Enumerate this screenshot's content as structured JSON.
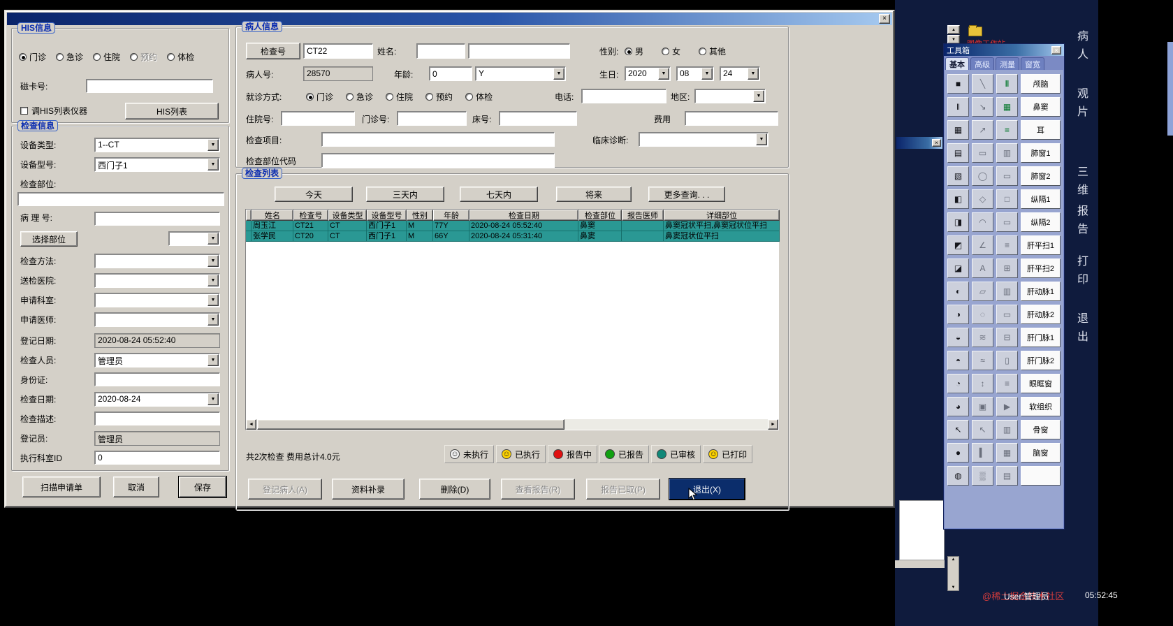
{
  "glyphs": {
    "arrow_down": "▼",
    "arrow_up": "▲",
    "arrow_left": "◄",
    "arrow_right": "►",
    "close": "×",
    "smiley": "☺"
  },
  "his": {
    "title": "HIS信息",
    "radios": [
      {
        "label": "门诊",
        "checked": true
      },
      {
        "label": "急诊"
      },
      {
        "label": "住院"
      },
      {
        "label": "预约",
        "disabled": true
      },
      {
        "label": "体检"
      }
    ],
    "card_label": "磁卡号:",
    "checkbox_label": "调HIS列表仪器",
    "his_list_button": "HIS列表"
  },
  "exam": {
    "title": "检查信息",
    "device_type_label": "设备类型:",
    "device_type": "1--CT",
    "device_model_label": "设备型号:",
    "device_model": "西门子1",
    "body_part_label": "检查部位:",
    "pathology_label": "病 理 号:",
    "select_part_button": "选择部位",
    "method_label": "检查方法:",
    "send_hospital_label": "送检医院:",
    "req_dept_label": "申请科室:",
    "req_doctor_label": "申请医师:",
    "reg_date_label": "登记日期:",
    "reg_date": "2020-08-24 05:52:40",
    "examiner_label": "检查人员:",
    "examiner": "管理员",
    "id_card_label": "身份证:",
    "exam_date_label": "检查日期:",
    "exam_date": "2020-08-24",
    "exam_desc_label": "检查描述:",
    "registrar_label": "登记员:",
    "registrar": "管理员",
    "exec_dept_label": "执行科室ID",
    "exec_dept": "0",
    "scan_button": "扫描申请单",
    "cancel_button": "取消",
    "save_button": "保存"
  },
  "patient": {
    "title": "病人信息",
    "exam_no_button": "检查号",
    "exam_no": "CT22",
    "name_label": "姓名:",
    "gender_label": "性别:",
    "genders": [
      {
        "label": "男",
        "checked": true
      },
      {
        "label": "女"
      },
      {
        "label": "其他"
      }
    ],
    "patient_no_label": "病人号:",
    "patient_no": "28570",
    "age_label": "年龄:",
    "age": "0",
    "age_unit": "Y",
    "birth_label": "生日:",
    "birth_year": "2020",
    "birth_month": "08",
    "birth_day": "24",
    "visit_label": "就诊方式:",
    "visit_radios": [
      {
        "label": "门诊",
        "checked": true
      },
      {
        "label": "急诊"
      },
      {
        "label": "住院"
      },
      {
        "label": "预约"
      },
      {
        "label": "体检"
      }
    ],
    "phone_label": "电话:",
    "region_label": "地区:",
    "inpatient_no_label": "住院号:",
    "outpatient_no_label": "门诊号:",
    "bed_no_label": "床号:",
    "fee_label": "费用",
    "exam_items_label": "检查项目:",
    "clinical_dx_label": "临床诊断:",
    "part_code_label": "检查部位代码"
  },
  "list": {
    "title": "检查列表",
    "quick_buttons": [
      "今天",
      "三天内",
      "七天内",
      "将来",
      "更多查询. . ."
    ],
    "columns": [
      "姓名",
      "检查号",
      "设备类型",
      "设备型号",
      "性别",
      "年龄",
      "检查日期",
      "检查部位",
      "报告医师",
      "详细部位"
    ],
    "rows": [
      [
        "周玉江",
        "CT21",
        "CT",
        "西门子1",
        "M",
        "77Y",
        "2020-08-24 05:52:40",
        "鼻窦",
        "",
        "鼻窦冠状平扫,鼻窦冠状位平扫"
      ],
      [
        "张学民",
        "CT20",
        "CT",
        "西门子1",
        "M",
        "66Y",
        "2020-08-24 05:31:40",
        "鼻窦",
        "",
        "鼻窦冠状位平扫"
      ]
    ],
    "summary": "共2次检查  费用总计4.0元",
    "statuses": [
      {
        "label": "未执行",
        "icon": "smiley",
        "color": "#f2f2f2"
      },
      {
        "label": "已执行",
        "icon": "smiley",
        "color": "#ffd400"
      },
      {
        "label": "报告中",
        "icon": "ball",
        "color": "#e01010"
      },
      {
        "label": "已报告",
        "icon": "ball",
        "color": "#10a010"
      },
      {
        "label": "已审核",
        "icon": "ball",
        "color": "#108878"
      },
      {
        "label": "已打印",
        "icon": "smiley",
        "color": "#ffd400"
      }
    ],
    "actions": [
      {
        "label": "登记病人(A)",
        "disabled": true
      },
      {
        "label": "资料补录"
      },
      {
        "label": "删除(D)"
      },
      {
        "label": "查看报告(R)",
        "disabled": true
      },
      {
        "label": "报告已取(P)",
        "disabled": true
      },
      {
        "label": "退出(X)",
        "primary": true
      }
    ]
  },
  "toolbox": {
    "title": "工具箱",
    "tabs": [
      {
        "label": "基本",
        "active": true
      },
      {
        "label": "高级"
      },
      {
        "label": "测量"
      },
      {
        "label": "窗宽"
      }
    ],
    "rows": [
      {
        "icons": [
          "■",
          "╲",
          "‖"
        ],
        "label": "颅脑"
      },
      {
        "icons": [
          "‖",
          "↘",
          "▦"
        ],
        "label": "鼻窦"
      },
      {
        "icons": [
          "▦",
          "↗",
          "≡"
        ],
        "label": "耳"
      },
      {
        "icons": [
          "▤",
          "▭",
          "▥"
        ],
        "label": "肺窗1"
      },
      {
        "icons": [
          "▧",
          "◯",
          "▭"
        ],
        "label": "肺窗2"
      },
      {
        "icons": [
          "◧",
          "◇",
          "□"
        ],
        "label": "纵隔1"
      },
      {
        "icons": [
          "◨",
          "◠",
          "▭"
        ],
        "label": "纵隔2"
      },
      {
        "icons": [
          "◩",
          "∠",
          "≡"
        ],
        "label": "肝平扫1"
      },
      {
        "icons": [
          "◪",
          "A",
          "⊞"
        ],
        "label": "肝平扫2"
      },
      {
        "icons": [
          "◐",
          "▱",
          "▥"
        ],
        "label": "肝动脉1"
      },
      {
        "icons": [
          "◑",
          "◌",
          "▭"
        ],
        "label": "肝动脉2"
      },
      {
        "icons": [
          "◒",
          "≋",
          "⊟"
        ],
        "label": "肝门脉1"
      },
      {
        "icons": [
          "◓",
          "≈",
          "▯"
        ],
        "label": "肝门脉2"
      },
      {
        "icons": [
          "◔",
          "↕",
          "≡"
        ],
        "label": "眼眶窗"
      },
      {
        "icons": [
          "◕",
          "▣",
          "▶"
        ],
        "label": "软组织"
      },
      {
        "icons": [
          "↖",
          "↖",
          "▥"
        ],
        "label": "骨窗"
      },
      {
        "icons": [
          "●",
          "▍",
          "▦"
        ],
        "label": "脑窗"
      },
      {
        "icons": [
          "◍",
          "▒",
          "▤"
        ],
        "label": ""
      }
    ]
  },
  "side_menu": [
    "病人",
    "观片",
    "三维",
    "报告",
    "打印",
    "退出"
  ],
  "desktop": {
    "red_label": "图像工作站",
    "user_label": "User:管理员",
    "time_label": "05:52:45",
    "watermark": "@稀土掘金技术社区"
  }
}
